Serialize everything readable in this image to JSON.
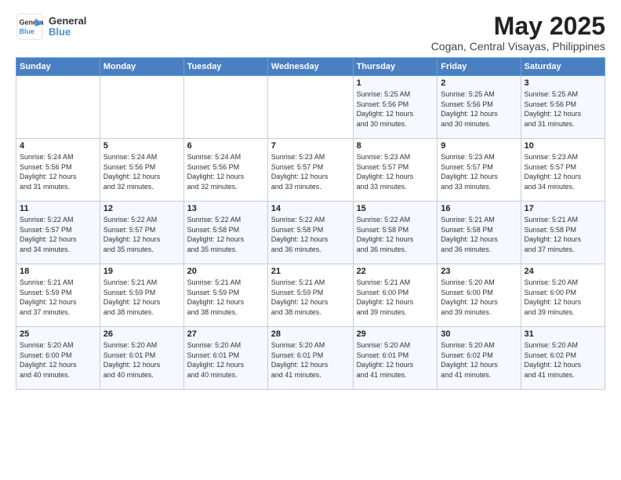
{
  "logo": {
    "general": "General",
    "blue": "Blue"
  },
  "title": "May 2025",
  "subtitle": "Cogan, Central Visayas, Philippines",
  "days_header": [
    "Sunday",
    "Monday",
    "Tuesday",
    "Wednesday",
    "Thursday",
    "Friday",
    "Saturday"
  ],
  "weeks": [
    [
      {
        "num": "",
        "info": ""
      },
      {
        "num": "",
        "info": ""
      },
      {
        "num": "",
        "info": ""
      },
      {
        "num": "",
        "info": ""
      },
      {
        "num": "1",
        "info": "Sunrise: 5:25 AM\nSunset: 5:56 PM\nDaylight: 12 hours\nand 30 minutes."
      },
      {
        "num": "2",
        "info": "Sunrise: 5:25 AM\nSunset: 5:56 PM\nDaylight: 12 hours\nand 30 minutes."
      },
      {
        "num": "3",
        "info": "Sunrise: 5:25 AM\nSunset: 5:56 PM\nDaylight: 12 hours\nand 31 minutes."
      }
    ],
    [
      {
        "num": "4",
        "info": "Sunrise: 5:24 AM\nSunset: 5:56 PM\nDaylight: 12 hours\nand 31 minutes."
      },
      {
        "num": "5",
        "info": "Sunrise: 5:24 AM\nSunset: 5:56 PM\nDaylight: 12 hours\nand 32 minutes."
      },
      {
        "num": "6",
        "info": "Sunrise: 5:24 AM\nSunset: 5:56 PM\nDaylight: 12 hours\nand 32 minutes."
      },
      {
        "num": "7",
        "info": "Sunrise: 5:23 AM\nSunset: 5:57 PM\nDaylight: 12 hours\nand 33 minutes."
      },
      {
        "num": "8",
        "info": "Sunrise: 5:23 AM\nSunset: 5:57 PM\nDaylight: 12 hours\nand 33 minutes."
      },
      {
        "num": "9",
        "info": "Sunrise: 5:23 AM\nSunset: 5:57 PM\nDaylight: 12 hours\nand 33 minutes."
      },
      {
        "num": "10",
        "info": "Sunrise: 5:23 AM\nSunset: 5:57 PM\nDaylight: 12 hours\nand 34 minutes."
      }
    ],
    [
      {
        "num": "11",
        "info": "Sunrise: 5:22 AM\nSunset: 5:57 PM\nDaylight: 12 hours\nand 34 minutes."
      },
      {
        "num": "12",
        "info": "Sunrise: 5:22 AM\nSunset: 5:57 PM\nDaylight: 12 hours\nand 35 minutes."
      },
      {
        "num": "13",
        "info": "Sunrise: 5:22 AM\nSunset: 5:58 PM\nDaylight: 12 hours\nand 35 minutes."
      },
      {
        "num": "14",
        "info": "Sunrise: 5:22 AM\nSunset: 5:58 PM\nDaylight: 12 hours\nand 36 minutes."
      },
      {
        "num": "15",
        "info": "Sunrise: 5:22 AM\nSunset: 5:58 PM\nDaylight: 12 hours\nand 36 minutes."
      },
      {
        "num": "16",
        "info": "Sunrise: 5:21 AM\nSunset: 5:58 PM\nDaylight: 12 hours\nand 36 minutes."
      },
      {
        "num": "17",
        "info": "Sunrise: 5:21 AM\nSunset: 5:58 PM\nDaylight: 12 hours\nand 37 minutes."
      }
    ],
    [
      {
        "num": "18",
        "info": "Sunrise: 5:21 AM\nSunset: 5:59 PM\nDaylight: 12 hours\nand 37 minutes."
      },
      {
        "num": "19",
        "info": "Sunrise: 5:21 AM\nSunset: 5:59 PM\nDaylight: 12 hours\nand 38 minutes."
      },
      {
        "num": "20",
        "info": "Sunrise: 5:21 AM\nSunset: 5:59 PM\nDaylight: 12 hours\nand 38 minutes."
      },
      {
        "num": "21",
        "info": "Sunrise: 5:21 AM\nSunset: 5:59 PM\nDaylight: 12 hours\nand 38 minutes."
      },
      {
        "num": "22",
        "info": "Sunrise: 5:21 AM\nSunset: 6:00 PM\nDaylight: 12 hours\nand 39 minutes."
      },
      {
        "num": "23",
        "info": "Sunrise: 5:20 AM\nSunset: 6:00 PM\nDaylight: 12 hours\nand 39 minutes."
      },
      {
        "num": "24",
        "info": "Sunrise: 5:20 AM\nSunset: 6:00 PM\nDaylight: 12 hours\nand 39 minutes."
      }
    ],
    [
      {
        "num": "25",
        "info": "Sunrise: 5:20 AM\nSunset: 6:00 PM\nDaylight: 12 hours\nand 40 minutes."
      },
      {
        "num": "26",
        "info": "Sunrise: 5:20 AM\nSunset: 6:01 PM\nDaylight: 12 hours\nand 40 minutes."
      },
      {
        "num": "27",
        "info": "Sunrise: 5:20 AM\nSunset: 6:01 PM\nDaylight: 12 hours\nand 40 minutes."
      },
      {
        "num": "28",
        "info": "Sunrise: 5:20 AM\nSunset: 6:01 PM\nDaylight: 12 hours\nand 41 minutes."
      },
      {
        "num": "29",
        "info": "Sunrise: 5:20 AM\nSunset: 6:01 PM\nDaylight: 12 hours\nand 41 minutes."
      },
      {
        "num": "30",
        "info": "Sunrise: 5:20 AM\nSunset: 6:02 PM\nDaylight: 12 hours\nand 41 minutes."
      },
      {
        "num": "31",
        "info": "Sunrise: 5:20 AM\nSunset: 6:02 PM\nDaylight: 12 hours\nand 41 minutes."
      }
    ]
  ]
}
